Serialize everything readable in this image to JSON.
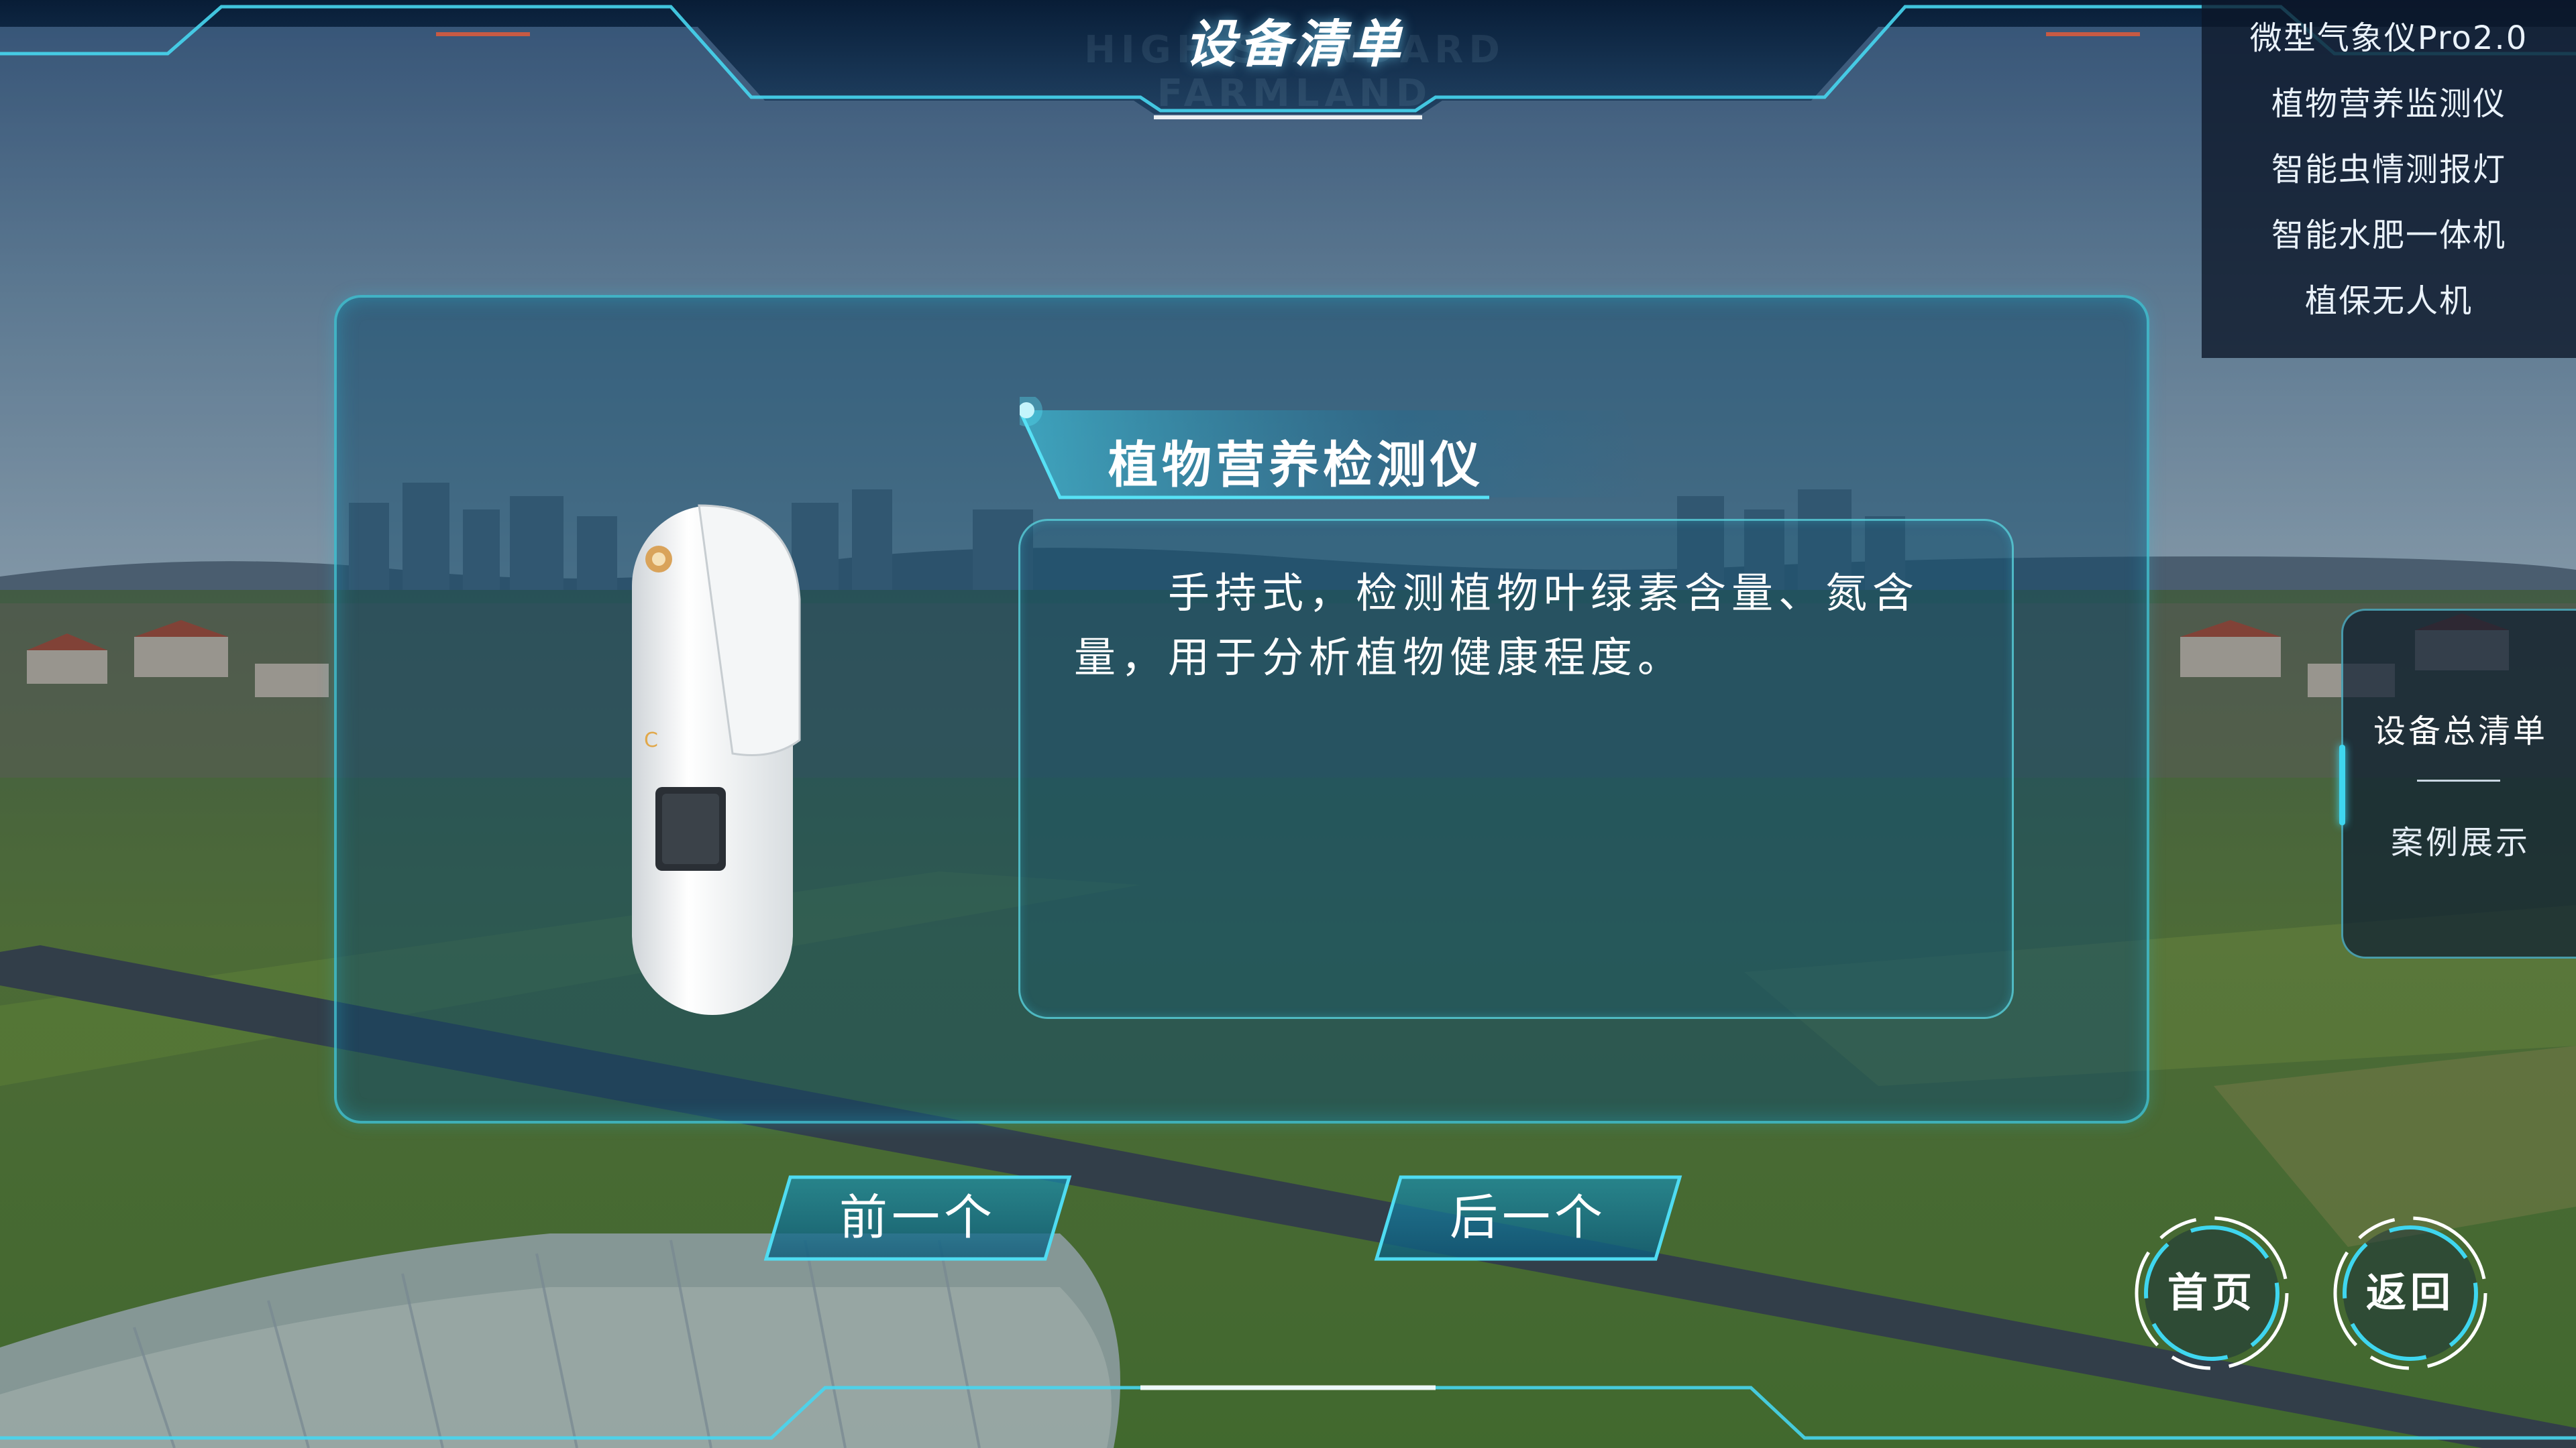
{
  "header": {
    "title": "设备清单",
    "watermark": "HIGH STANDARD FARMLAND"
  },
  "device_list": {
    "items": [
      {
        "label": "微型气象仪Pro2.0"
      },
      {
        "label": "植物营养监测仪"
      },
      {
        "label": "智能虫情测报灯"
      },
      {
        "label": "智能水肥一体机"
      },
      {
        "label": "植保无人机"
      }
    ]
  },
  "detail": {
    "title": "植物营养检测仪",
    "description": "手持式，检测植物叶绿素含量、氮含量，用于分析植物健康程度。",
    "device_icon": "handheld-device-icon"
  },
  "nav": {
    "prev_label": "前一个",
    "next_label": "后一个"
  },
  "side_menu": {
    "item_1": "设备总清单",
    "item_2": "案例展示"
  },
  "buttons": {
    "home_label": "首页",
    "back_label": "返回"
  },
  "colors": {
    "accent": "#3fd6ef",
    "panel_border": "#46cddc",
    "panel_fill": "#124869"
  }
}
